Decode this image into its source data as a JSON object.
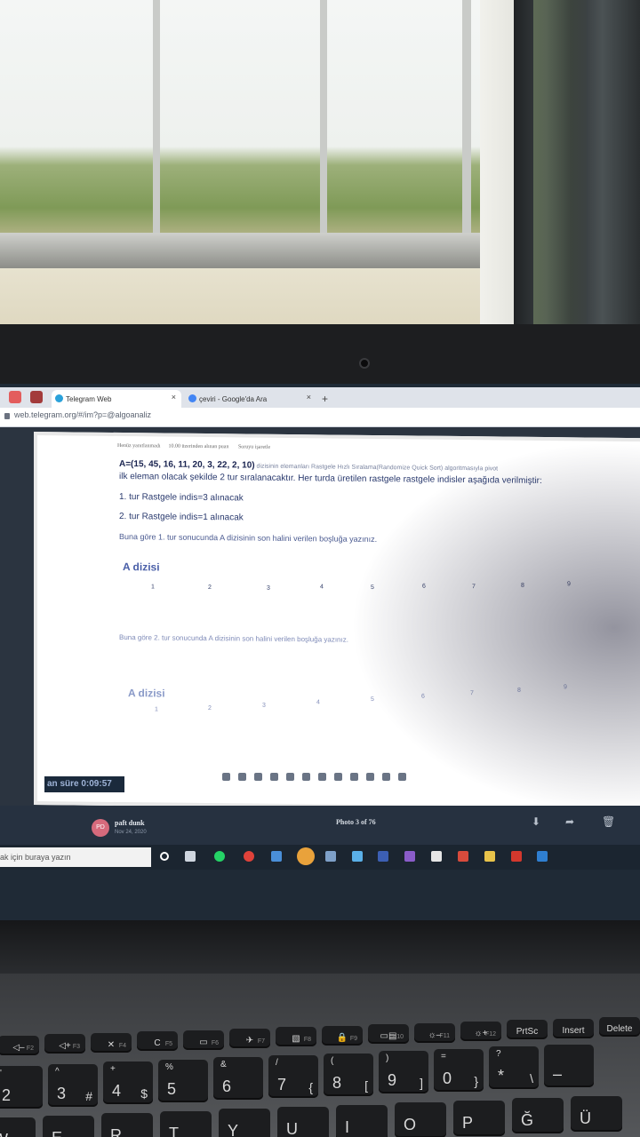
{
  "browser": {
    "tabs": [
      {
        "label": "Telegram Web",
        "close": "×"
      },
      {
        "label": "çeviri - Google'da Ara",
        "close": "×"
      }
    ],
    "new_tab": "+",
    "url": "web.telegram.org/#/im?p=@algoanaliz"
  },
  "exam": {
    "header_left": "Henüz yanıtlanmadı",
    "header_mid": "10.00 üzerinden alınan puan",
    "header_right": "Soruyu işaretle",
    "question_line1_bold": "A=(15, 45, 16, 11, 20, 3, 22, 2, 10)",
    "question_line1_rest": " dizisinin elemanları Rastgele Hızlı Sıralama(Randomize Quick Sort) algoritmasıyla  pivot",
    "question_line2": "ilk eleman olacak şekilde 2 tur sıralanacaktır. Her turda üretilen rastgele rastgele indisler aşağıda verilmiştir:",
    "tur1": "1. tur Rastgele indis=3 alınacak",
    "tur2": "2. tur Rastgele indis=1 alınacak",
    "prompt1": "Buna göre 1. tur sonucunda A dizisinin son halini verilen boşluğa yazınız.",
    "prompt2": "Buna göre 2. tur sonucunda A dizisinin son halini verilen boşluğa yazınız.",
    "array_title": "A dizisi",
    "indices": [
      "1",
      "2",
      "3",
      "4",
      "5",
      "6",
      "7",
      "8",
      "9"
    ],
    "timer": "an süre 0:09:57"
  },
  "viewer": {
    "avatar_initials": "PD",
    "sender": "paft dunk",
    "date": "Nov 24, 2020",
    "photo_count": "Photo 3 of 76"
  },
  "taskbar": {
    "search_placeholder": "ak için buraya yazın"
  },
  "keyboard": {
    "fn_row": [
      {
        "main": "◁–",
        "sub": "F2"
      },
      {
        "main": "◁+",
        "sub": "F3"
      },
      {
        "main": "✕",
        "sub": "F4"
      },
      {
        "main": "C",
        "sub": "F5"
      },
      {
        "main": "▭",
        "sub": "F6"
      },
      {
        "main": "✈",
        "sub": "F7"
      },
      {
        "main": "▧",
        "sub": "F8"
      },
      {
        "main": "🔒",
        "sub": "F9"
      },
      {
        "main": "▭▤",
        "sub": "F10"
      },
      {
        "main": "☼–",
        "sub": "F11"
      },
      {
        "main": "☼+",
        "sub": "F12"
      },
      {
        "main": "PrtSc",
        "sub": ""
      },
      {
        "main": "Insert",
        "sub": ""
      },
      {
        "main": "Delete",
        "sub": ""
      }
    ],
    "num_row": [
      {
        "top": "'",
        "main": "2",
        "sub": ""
      },
      {
        "top": "^",
        "main": "3",
        "sub": "#"
      },
      {
        "top": "+",
        "main": "4",
        "sub": "$"
      },
      {
        "top": "%",
        "main": "5",
        "sub": ""
      },
      {
        "top": "&",
        "main": "6",
        "sub": ""
      },
      {
        "top": "/",
        "main": "7",
        "sub": "{"
      },
      {
        "top": "(",
        "main": "8",
        "sub": "["
      },
      {
        "top": ")",
        "main": "9",
        "sub": "]"
      },
      {
        "top": "=",
        "main": "0",
        "sub": "}"
      },
      {
        "top": "?",
        "main": "*",
        "sub": "\\"
      },
      {
        "top": "",
        "main": "–",
        "sub": ""
      }
    ],
    "letter_row": [
      "W",
      "E",
      "R",
      "T",
      "Y",
      "U",
      "I",
      "O",
      "P",
      "Ğ",
      "Ü"
    ]
  }
}
